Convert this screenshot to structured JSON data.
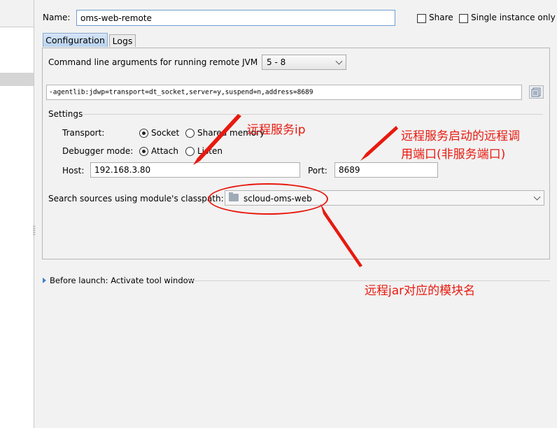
{
  "name": {
    "label": "Name:",
    "value": "oms-web-remote"
  },
  "share": {
    "label": "Share"
  },
  "single_instance": {
    "label": "Single instance only"
  },
  "tabs": [
    {
      "label": "Configuration"
    },
    {
      "label": "Logs"
    }
  ],
  "jvm": {
    "label": "Command line arguments for running remote JVM",
    "value": "5 - 8"
  },
  "args": {
    "value": "-agentlib:jdwp=transport=dt_socket,server=y,suspend=n,address=8689"
  },
  "settings": {
    "title": "Settings",
    "transport_label": "Transport:",
    "transport_options": [
      "Socket",
      "Shared memory"
    ],
    "transport_selected": "Socket",
    "debugger_label": "Debugger mode:",
    "debugger_options": [
      "Attach",
      "Listen"
    ],
    "debugger_selected": "Attach",
    "host_label": "Host:",
    "host_value": "192.168.3.80",
    "port_label": "Port:",
    "port_value": "8689"
  },
  "module": {
    "label": "Search sources using module's classpath:",
    "value": "scloud-oms-web"
  },
  "before_launch": {
    "label": "Before launch: Activate tool window"
  },
  "annotations": {
    "remote_ip": "远程服务ip",
    "remote_port_line1": "远程服务启动的远程调",
    "remote_port_line2": "用端口(非服务端口)",
    "module_name": "远程jar对应的模块名"
  },
  "colors": {
    "annotation": "#e8190f",
    "tab_active": "#c7dcf3",
    "focus_border": "#6d9ed3"
  }
}
